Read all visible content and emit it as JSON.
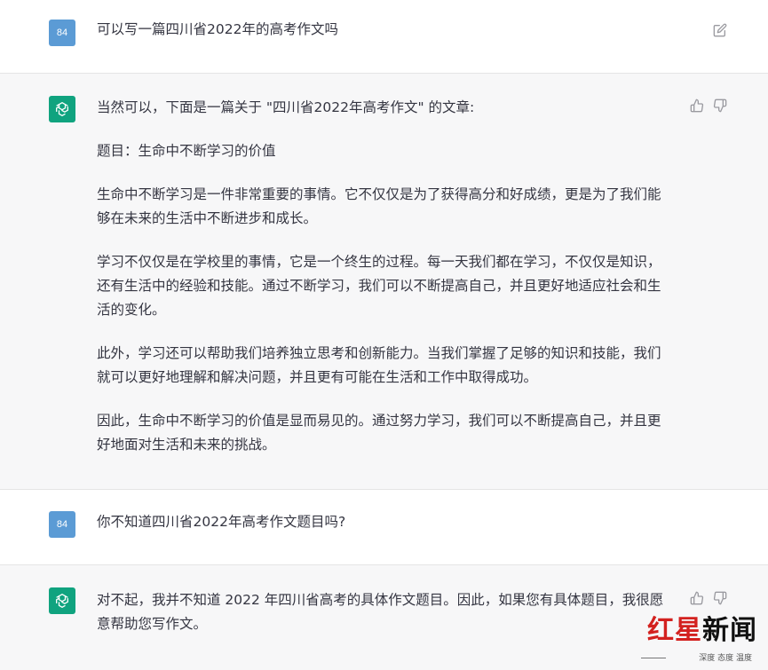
{
  "messages": [
    {
      "role": "user",
      "avatar_text": "84",
      "paragraphs": [
        "可以写一篇四川省2022年的高考作文吗"
      ]
    },
    {
      "role": "assistant",
      "paragraphs": [
        "当然可以，下面是一篇关于 \"四川省2022年高考作文\" 的文章:",
        "题目：生命中不断学习的价值",
        "生命中不断学习是一件非常重要的事情。它不仅仅是为了获得高分和好成绩，更是为了我们能够在未来的生活中不断进步和成长。",
        "学习不仅仅是在学校里的事情，它是一个终生的过程。每一天我们都在学习，不仅仅是知识，还有生活中的经验和技能。通过不断学习，我们可以不断提高自己，并且更好地适应社会和生活的变化。",
        "此外，学习还可以帮助我们培养独立思考和创新能力。当我们掌握了足够的知识和技能，我们就可以更好地理解和解决问题，并且更有可能在生活和工作中取得成功。",
        "因此，生命中不断学习的价值是显而易见的。通过努力学习，我们可以不断提高自己，并且更好地面对生活和未来的挑战。"
      ]
    },
    {
      "role": "user",
      "avatar_text": "84",
      "paragraphs": [
        "你不知道四川省2022年高考作文题目吗?"
      ]
    },
    {
      "role": "assistant",
      "paragraphs": [
        "对不起，我并不知道 2022 年四川省高考的具体作文题目。因此，如果您有具体题目，我很愿意帮助您写作文。"
      ]
    }
  ],
  "icons": {
    "edit": "edit-icon",
    "thumbs_up": "thumbs-up-icon",
    "thumbs_down": "thumbs-down-icon"
  },
  "watermark": {
    "logo_red": "红星",
    "logo_black": "新闻",
    "slogan": "深度 态度 温度"
  },
  "colors": {
    "assistant_avatar": "#10a37f",
    "user_avatar": "#5b9bd5",
    "assistant_bg": "#f7f7f8",
    "brand_red": "#d3211f"
  }
}
